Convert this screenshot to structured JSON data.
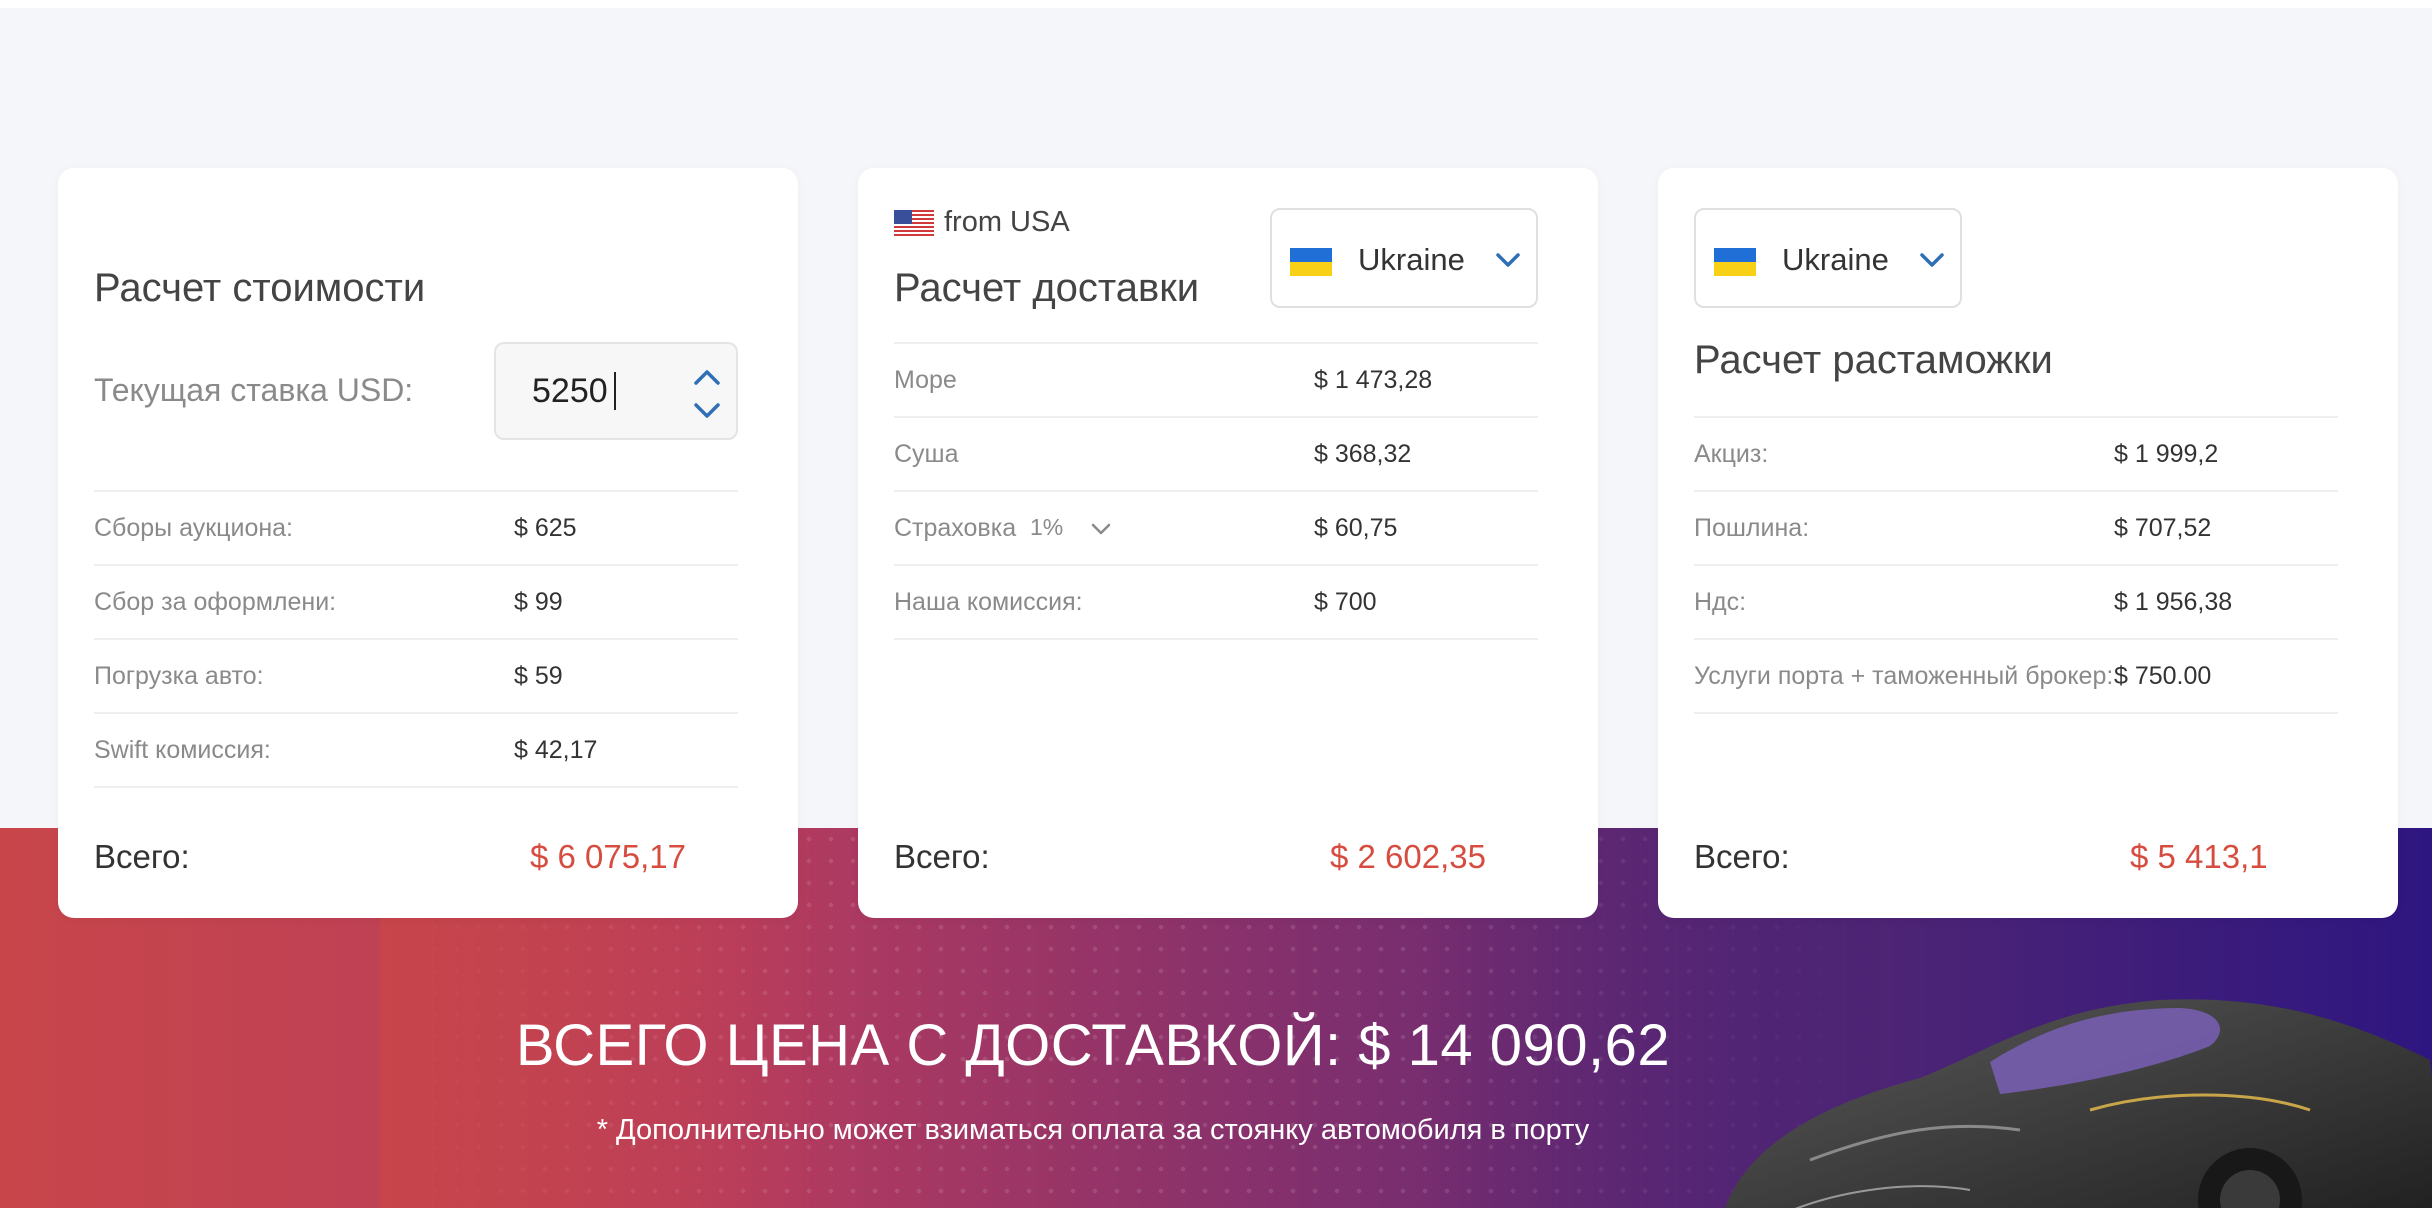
{
  "cost_card": {
    "title": "Расчет стоимости",
    "rate_label": "Текущая ставка USD:",
    "rate_value": "5250",
    "rows": [
      {
        "label": "Сборы аукциона:",
        "value": "$ 625"
      },
      {
        "label": "Сбор за оформлени:",
        "value": "$ 99"
      },
      {
        "label": "Погрузка авто:",
        "value": "$ 59"
      },
      {
        "label": "Swift комиссия:",
        "value": "$ 42,17"
      }
    ],
    "total_label": "Всего:",
    "total_value": "$ 6 075,17"
  },
  "delivery_card": {
    "origin": "from USA",
    "country": "Ukraine",
    "title": "Расчет доставки",
    "rows": [
      {
        "label": "Море",
        "value": "$ 1 473,28"
      },
      {
        "label": "Суша",
        "value": "$ 368,32"
      },
      {
        "label": "Страховка",
        "value": "$ 60,75",
        "option": "1%"
      },
      {
        "label": "Наша комиссия:",
        "value": "$ 700"
      }
    ],
    "total_label": "Всего:",
    "total_value": "$ 2 602,35"
  },
  "customs_card": {
    "country": "Ukraine",
    "title": "Расчет растаможки",
    "rows": [
      {
        "label": "Акциз:",
        "value": "$ 1 999,2"
      },
      {
        "label": "Пошлина:",
        "value": "$ 707,52"
      },
      {
        "label": "Ндс:",
        "value": "$ 1 956,38"
      },
      {
        "label": "Услуги порта + таможенный брокер:",
        "value": "$ 750.00"
      }
    ],
    "total_label": "Всего:",
    "total_value": "$ 5 413,1"
  },
  "banner": {
    "grand_total": "ВСЕГО ЦЕНА С ДОСТАВКОЙ: $ 14 090,62",
    "note": "* Дополнительно может взиматься оплата за стоянку автомобиля в порту"
  },
  "colors": {
    "accent_red": "#d64c3f",
    "chevron_blue": "#2f6fb5",
    "ukraine_blue": "#1f6fd6",
    "ukraine_yellow": "#f8d117"
  },
  "icons": {
    "spinner_up": "chevron-up-icon",
    "spinner_down": "chevron-down-icon",
    "country_select": "chevron-down-icon",
    "usa_flag": "usa-flag-icon",
    "ukraine_flag": "ukraine-flag-icon"
  }
}
